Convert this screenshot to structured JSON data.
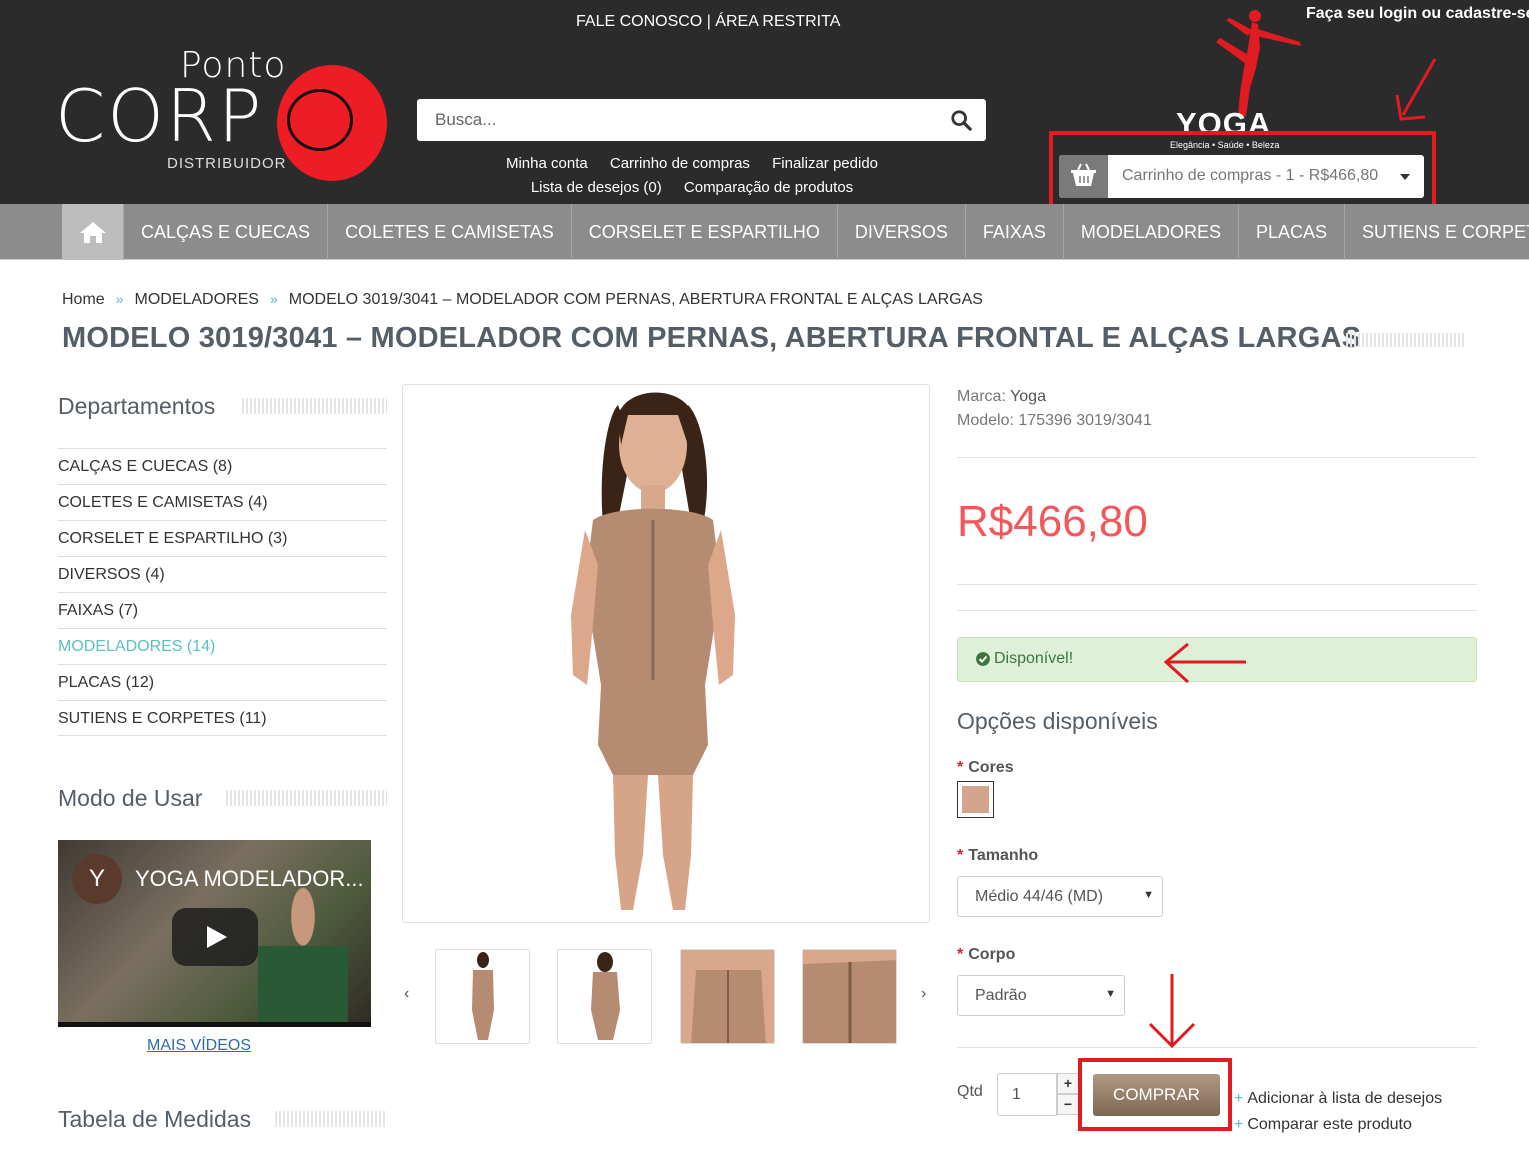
{
  "header": {
    "top_links": "FALE CONOSCO | ÁREA RESTRITA",
    "login_text": "Faça seu login ou cadastre-se",
    "logo": {
      "ponto": "Ponto",
      "corpo": "CORP",
      "distribuidor": "DISTRIBUIDOR"
    },
    "search_placeholder": "Busca...",
    "account_links": [
      "Minha conta",
      "Carrinho de compras",
      "Finalizar pedido",
      "Lista de desejos (0)",
      "Comparação de produtos"
    ],
    "brand_logo": {
      "word": "YOGA",
      "tagline": "Elegância • Saúde • Beleza"
    },
    "cart_text": "Carrinho de compras - 1 - R$466,80"
  },
  "nav": {
    "items": [
      "CALÇAS E CUECAS",
      "COLETES E CAMISETAS",
      "CORSELET E ESPARTILHO",
      "DIVERSOS",
      "FAIXAS",
      "MODELADORES",
      "PLACAS",
      "SUTIENS E CORPETES"
    ]
  },
  "breadcrumb": {
    "items": [
      "Home",
      "MODELADORES",
      "MODELO 3019/3041 – MODELADOR COM PERNAS, ABERTURA FRONTAL E ALÇAS LARGAS"
    ],
    "sep": "»"
  },
  "product": {
    "title": "MODELO 3019/3041 – MODELADOR COM PERNAS, ABERTURA FRONTAL E ALÇAS LARGAS",
    "brand_label": "Marca:",
    "brand": "Yoga",
    "model_label": "Modelo:",
    "model": "175396 3019/3041",
    "price": "R$466,80",
    "availability": "Disponível!",
    "options_heading": "Opções disponíveis",
    "colors_label": "Cores",
    "color_swatch": "#d4a58c",
    "size_label": "Tamanho",
    "size_value": "Médio 44/46 (MD)",
    "body_label": "Corpo",
    "body_value": "Padrão",
    "qty_label": "Qtd",
    "qty_value": "1",
    "buy_label": "COMPRAR",
    "wishlist_label": "Adicionar à lista de desejos",
    "compare_label": "Comparar este produto"
  },
  "sidebar": {
    "departments_heading": "Departamentos",
    "categories": [
      {
        "label": "CALÇAS E CUECAS (8)"
      },
      {
        "label": "COLETES E CAMISETAS (4)"
      },
      {
        "label": "CORSELET E ESPARTILHO (3)"
      },
      {
        "label": "DIVERSOS (4)"
      },
      {
        "label": "FAIXAS (7)"
      },
      {
        "label": "MODELADORES (14)"
      },
      {
        "label": "PLACAS (12)"
      },
      {
        "label": "SUTIENS E CORPETES (11)"
      }
    ],
    "usage_heading": "Modo de Usar",
    "video_avatar": "Y",
    "video_title": "YOGA MODELADOR...",
    "more_videos": "MAIS VÍDEOS",
    "measures_heading": "Tabela de Medidas"
  },
  "colors": {
    "accent": "#5bc0be",
    "price": "#f2585a",
    "annotation": "#e21b23",
    "header_bg": "#2b2b2b",
    "nav_bg": "#8c8c8c"
  }
}
